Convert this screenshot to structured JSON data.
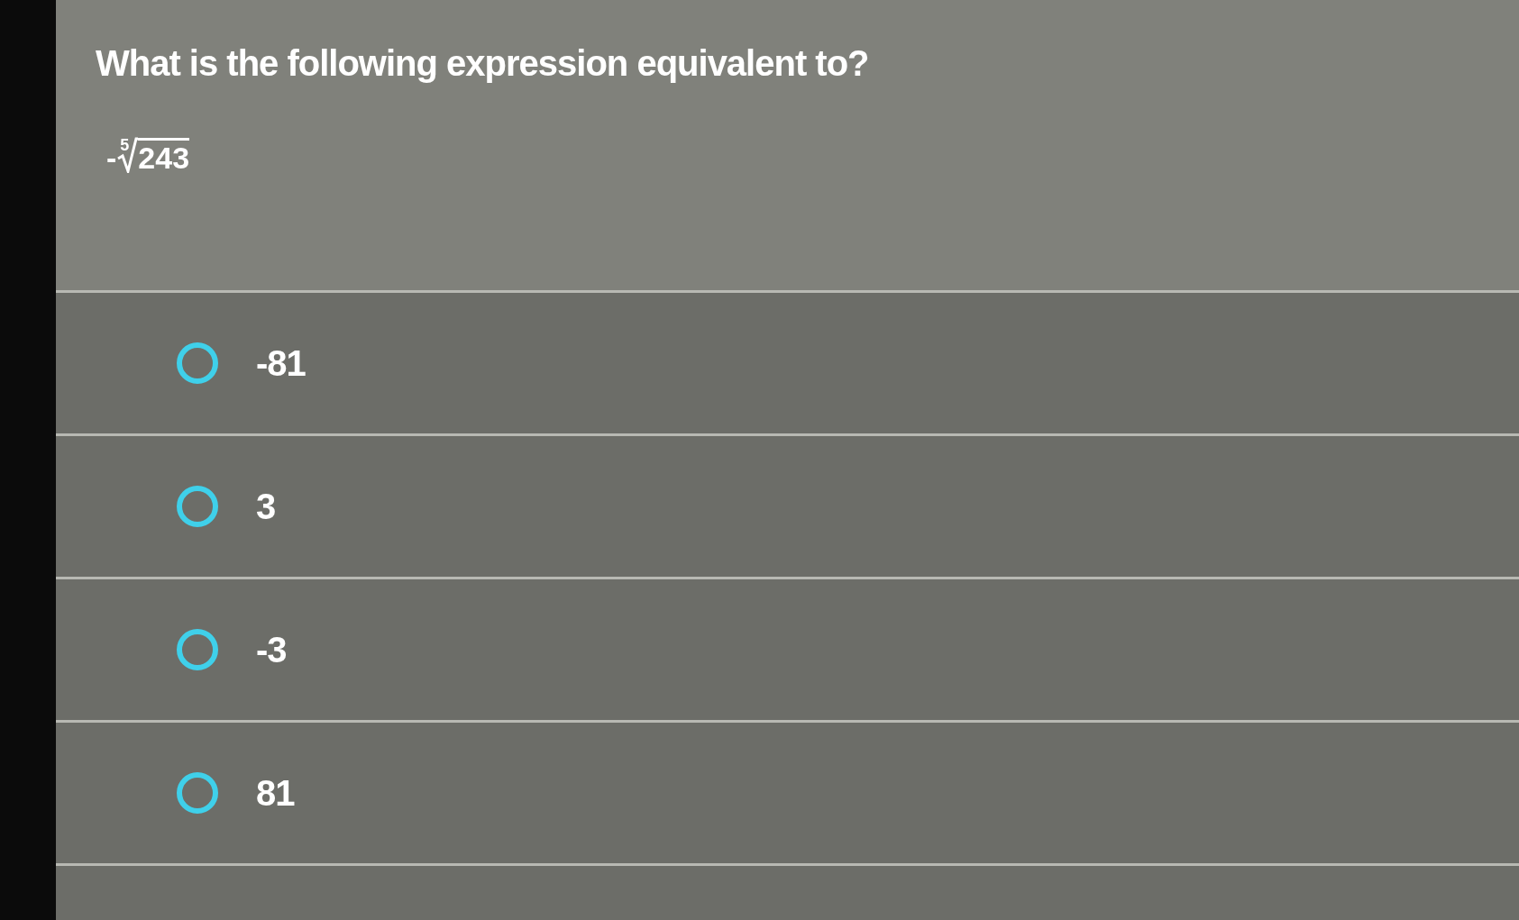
{
  "question": "What is the following expression equivalent to?",
  "expression": {
    "sign": "-",
    "index": "5",
    "radicand": "243"
  },
  "options": [
    {
      "label": "-81",
      "selected": false
    },
    {
      "label": "3",
      "selected": false
    },
    {
      "label": "-3",
      "selected": false
    },
    {
      "label": "81",
      "selected": false
    }
  ]
}
